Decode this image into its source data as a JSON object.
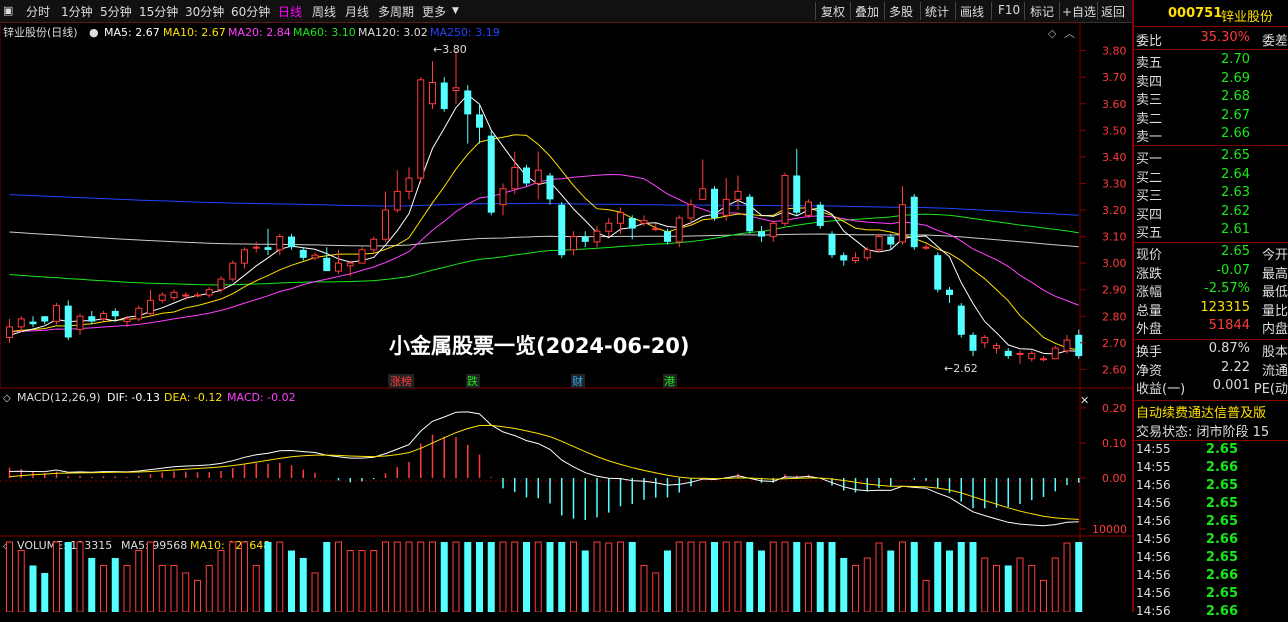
{
  "toolbar": {
    "periods": [
      "分时",
      "1分钟",
      "5分钟",
      "15分钟",
      "30分钟",
      "60分钟",
      "日线",
      "周线",
      "月线",
      "多周期",
      "更多"
    ],
    "active": "日线",
    "right": [
      "复权",
      "叠加",
      "多股",
      "统计",
      "画线",
      "F10",
      "标记",
      "+自选",
      "返回"
    ]
  },
  "chart_header": {
    "name": "锌业股份(日线)",
    "ma": [
      {
        "label": "MA5: 2.67",
        "color": "#ffffff"
      },
      {
        "label": "MA10: 2.67",
        "color": "#ffe000"
      },
      {
        "label": "MA20: 2.84",
        "color": "#ff40ff"
      },
      {
        "label": "MA60: 3.10",
        "color": "#18e818"
      },
      {
        "label": "MA120: 3.02",
        "color": "#dddddd"
      },
      {
        "label": "MA250: 3.19",
        "color": "#2244ff"
      }
    ]
  },
  "overlay_title": "小金属股票一览(2024-06-20)",
  "high_marker": "3.80",
  "low_marker": "2.62",
  "event_tags": [
    {
      "text": "涨榜",
      "color": "#ff3b3b"
    },
    {
      "text": "跌",
      "color": "#18e818"
    },
    {
      "text": "财",
      "color": "#33aaff"
    },
    {
      "text": "港",
      "color": "#18e818"
    }
  ],
  "price_axis": [
    "3.80",
    "3.70",
    "3.60",
    "3.50",
    "3.40",
    "3.30",
    "3.20",
    "3.10",
    "3.00",
    "2.90",
    "2.80",
    "2.70",
    "2.60"
  ],
  "macd_header": [
    {
      "label": "MACD(12,26,9)",
      "color": "#dddddd"
    },
    {
      "label": "DIF: -0.13",
      "color": "#ffffff"
    },
    {
      "label": "DEA: -0.12",
      "color": "#ffe000"
    },
    {
      "label": "MACD: -0.02",
      "color": "#ff40ff"
    }
  ],
  "macd_axis": [
    "0.20",
    "0.10",
    "0.00"
  ],
  "volume_header": [
    {
      "label": "VOLUME: 123315",
      "color": "#dddddd"
    },
    {
      "label": "MA5: 99568",
      "color": "#dddddd"
    },
    {
      "label": "MA10: 121648",
      "color": "#ffe000"
    }
  ],
  "volume_axis": [
    "10000"
  ],
  "chart_data": {
    "type": "candlestick",
    "ylim": [
      2.56,
      3.84
    ],
    "candles": [
      [
        2.72,
        2.76,
        2.7,
        2.79
      ],
      [
        2.76,
        2.79,
        2.74,
        2.8
      ],
      [
        2.78,
        2.77,
        2.76,
        2.8
      ],
      [
        2.8,
        2.78,
        2.77,
        2.8
      ],
      [
        2.78,
        2.84,
        2.77,
        2.85
      ],
      [
        2.84,
        2.72,
        2.71,
        2.86
      ],
      [
        2.75,
        2.8,
        2.73,
        2.81
      ],
      [
        2.8,
        2.78,
        2.77,
        2.82
      ],
      [
        2.79,
        2.81,
        2.78,
        2.82
      ],
      [
        2.82,
        2.8,
        2.78,
        2.83
      ],
      [
        2.78,
        2.79,
        2.76,
        2.8
      ],
      [
        2.79,
        2.83,
        2.78,
        2.84
      ],
      [
        2.81,
        2.86,
        2.8,
        2.9
      ],
      [
        2.86,
        2.88,
        2.85,
        2.89
      ],
      [
        2.87,
        2.89,
        2.86,
        2.9
      ],
      [
        2.88,
        2.88,
        2.86,
        2.89
      ],
      [
        2.88,
        2.88,
        2.87,
        2.89
      ],
      [
        2.88,
        2.9,
        2.87,
        2.91
      ],
      [
        2.9,
        2.94,
        2.89,
        2.95
      ],
      [
        2.94,
        3.0,
        2.93,
        3.01
      ],
      [
        3.0,
        3.05,
        2.98,
        3.06
      ],
      [
        3.06,
        3.06,
        3.04,
        3.08
      ],
      [
        3.06,
        3.05,
        3.03,
        3.13
      ],
      [
        3.05,
        3.1,
        3.03,
        3.11
      ],
      [
        3.1,
        3.06,
        3.05,
        3.11
      ],
      [
        3.05,
        3.02,
        3.01,
        3.06
      ],
      [
        3.02,
        3.03,
        3.01,
        3.04
      ],
      [
        3.02,
        2.97,
        2.97,
        3.06
      ],
      [
        2.97,
        3.0,
        2.96,
        3.05
      ],
      [
        2.99,
        3.0,
        2.95,
        3.01
      ],
      [
        3.0,
        3.05,
        3.0,
        3.06
      ],
      [
        3.05,
        3.09,
        3.04,
        3.1
      ],
      [
        3.09,
        3.2,
        3.08,
        3.27
      ],
      [
        3.2,
        3.27,
        3.19,
        3.35
      ],
      [
        3.27,
        3.32,
        3.24,
        3.36
      ],
      [
        3.32,
        3.69,
        3.3,
        3.7
      ],
      [
        3.6,
        3.68,
        3.58,
        3.76
      ],
      [
        3.68,
        3.58,
        3.57,
        3.7
      ],
      [
        3.65,
        3.66,
        3.6,
        3.8
      ],
      [
        3.65,
        3.56,
        3.45,
        3.67
      ],
      [
        3.56,
        3.51,
        3.45,
        3.6
      ],
      [
        3.48,
        3.19,
        3.18,
        3.5
      ],
      [
        3.22,
        3.28,
        3.18,
        3.3
      ],
      [
        3.28,
        3.36,
        3.26,
        3.42
      ],
      [
        3.36,
        3.3,
        3.29,
        3.37
      ],
      [
        3.3,
        3.35,
        3.24,
        3.42
      ],
      [
        3.33,
        3.24,
        3.22,
        3.34
      ],
      [
        3.22,
        3.03,
        3.02,
        3.23
      ],
      [
        3.05,
        3.1,
        3.03,
        3.12
      ],
      [
        3.1,
        3.08,
        3.06,
        3.12
      ],
      [
        3.08,
        3.12,
        3.06,
        3.14
      ],
      [
        3.12,
        3.15,
        3.1,
        3.17
      ],
      [
        3.15,
        3.19,
        3.11,
        3.21
      ],
      [
        3.17,
        3.13,
        3.09,
        3.18
      ],
      [
        3.15,
        3.16,
        3.14,
        3.18
      ],
      [
        3.13,
        3.13,
        3.12,
        3.15
      ],
      [
        3.12,
        3.08,
        3.07,
        3.13
      ],
      [
        3.08,
        3.17,
        3.06,
        3.18
      ],
      [
        3.17,
        3.22,
        3.14,
        3.24
      ],
      [
        3.24,
        3.28,
        3.24,
        3.39
      ],
      [
        3.28,
        3.17,
        3.16,
        3.29
      ],
      [
        3.18,
        3.24,
        3.16,
        3.32
      ],
      [
        3.24,
        3.27,
        3.2,
        3.33
      ],
      [
        3.25,
        3.12,
        3.11,
        3.26
      ],
      [
        3.12,
        3.1,
        3.08,
        3.14
      ],
      [
        3.1,
        3.15,
        3.08,
        3.16
      ],
      [
        3.15,
        3.33,
        3.14,
        3.34
      ],
      [
        3.33,
        3.19,
        3.18,
        3.43
      ],
      [
        3.18,
        3.23,
        3.17,
        3.24
      ],
      [
        3.22,
        3.14,
        3.13,
        3.23
      ],
      [
        3.11,
        3.03,
        3.02,
        3.12
      ],
      [
        3.03,
        3.01,
        2.99,
        3.04
      ],
      [
        3.01,
        3.02,
        3.0,
        3.04
      ],
      [
        3.02,
        3.05,
        3.01,
        3.06
      ],
      [
        3.05,
        3.1,
        3.04,
        3.11
      ],
      [
        3.1,
        3.07,
        3.05,
        3.11
      ],
      [
        3.08,
        3.22,
        3.07,
        3.29
      ],
      [
        3.25,
        3.06,
        3.05,
        3.26
      ],
      [
        3.06,
        3.06,
        3.05,
        3.07
      ],
      [
        3.03,
        2.9,
        2.89,
        3.04
      ],
      [
        2.9,
        2.88,
        2.85,
        2.91
      ],
      [
        2.84,
        2.73,
        2.72,
        2.85
      ],
      [
        2.73,
        2.67,
        2.65,
        2.74
      ],
      [
        2.7,
        2.72,
        2.68,
        2.73
      ],
      [
        2.68,
        2.69,
        2.66,
        2.7
      ],
      [
        2.67,
        2.65,
        2.64,
        2.68
      ],
      [
        2.66,
        2.66,
        2.62,
        2.67
      ],
      [
        2.64,
        2.66,
        2.63,
        2.67
      ],
      [
        2.64,
        2.64,
        2.63,
        2.65
      ],
      [
        2.64,
        2.68,
        2.64,
        2.69
      ],
      [
        2.67,
        2.71,
        2.66,
        2.73
      ],
      [
        2.73,
        2.65,
        2.64,
        2.75
      ]
    ],
    "macd_ylim": [
      -0.16,
      0.24
    ],
    "volume_ylim": [
      0,
      16000
    ]
  },
  "quote": {
    "code": "000751",
    "name": "锌业股份",
    "ratio_label": "委比",
    "ratio_value": "35.30%",
    "ratio_right": "委差",
    "asks": [
      {
        "label": "卖五",
        "price": "2.70"
      },
      {
        "label": "卖四",
        "price": "2.69"
      },
      {
        "label": "卖三",
        "price": "2.68"
      },
      {
        "label": "卖二",
        "price": "2.67"
      },
      {
        "label": "卖一",
        "price": "2.66"
      }
    ],
    "bids": [
      {
        "label": "买一",
        "price": "2.65"
      },
      {
        "label": "买二",
        "price": "2.64"
      },
      {
        "label": "买三",
        "price": "2.63"
      },
      {
        "label": "买四",
        "price": "2.62"
      },
      {
        "label": "买五",
        "price": "2.61"
      }
    ],
    "stats": [
      {
        "label": "现价",
        "value": "2.65",
        "color": "#18e818",
        "right": "今开"
      },
      {
        "label": "涨跌",
        "value": "-0.07",
        "color": "#18e818",
        "right": "最高"
      },
      {
        "label": "涨幅",
        "value": "-2.57%",
        "color": "#18e818",
        "right": "最低"
      },
      {
        "label": "总量",
        "value": "123315",
        "color": "#ffe000",
        "right": "量比"
      },
      {
        "label": "外盘",
        "value": "51844",
        "color": "#ff3b3b",
        "right": "内盘"
      }
    ],
    "stats2": [
      {
        "label": "换手",
        "value": "0.87%",
        "right": "股本"
      },
      {
        "label": "净资",
        "value": "2.22",
        "right": "流通"
      },
      {
        "label": "收益(一)",
        "value": "0.001",
        "right": "PE(动"
      }
    ],
    "notice": "自动续费通达信普及版",
    "trade_state": "交易状态: 闭市阶段 15",
    "ticks": [
      {
        "time": "14:55",
        "price": "2.65"
      },
      {
        "time": "14:55",
        "price": "2.66"
      },
      {
        "time": "14:56",
        "price": "2.65"
      },
      {
        "time": "14:56",
        "price": "2.65"
      },
      {
        "time": "14:56",
        "price": "2.65"
      },
      {
        "time": "14:56",
        "price": "2.66"
      },
      {
        "time": "14:56",
        "price": "2.65"
      },
      {
        "time": "14:56",
        "price": "2.66"
      },
      {
        "time": "14:56",
        "price": "2.65"
      },
      {
        "time": "14:56",
        "price": "2.66"
      }
    ]
  }
}
